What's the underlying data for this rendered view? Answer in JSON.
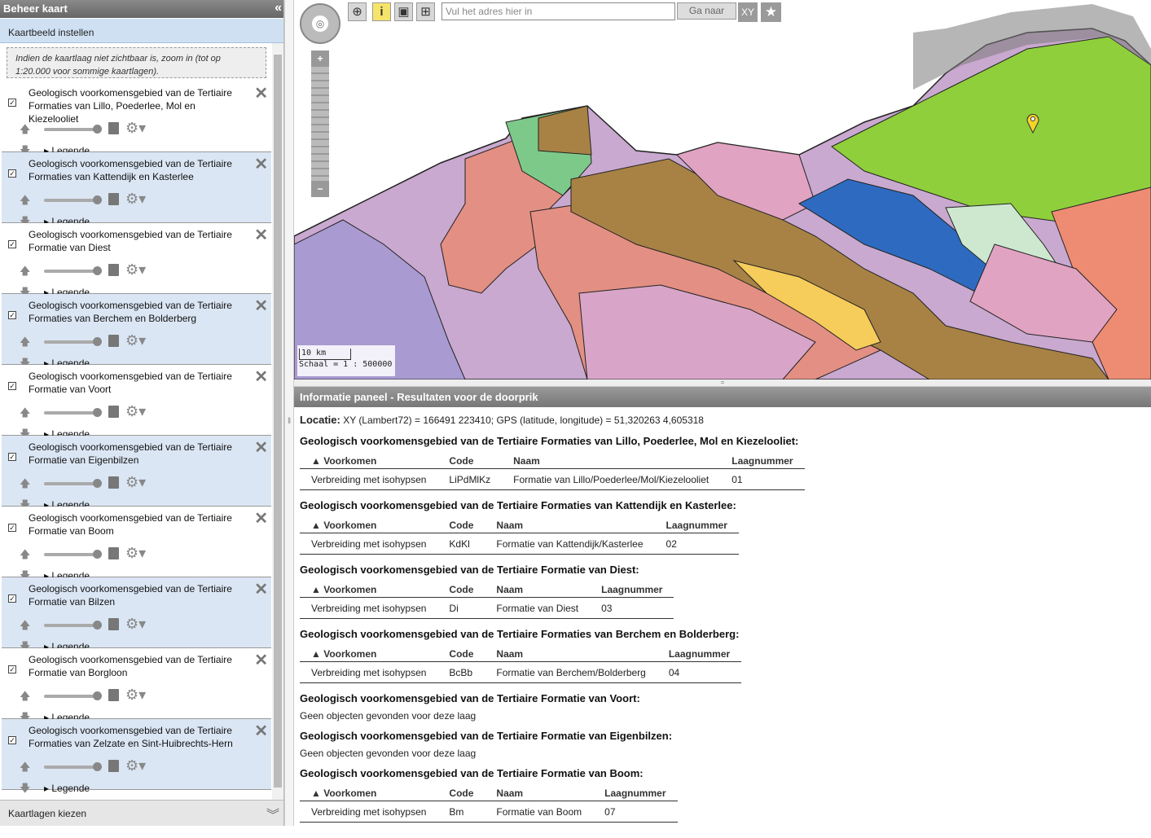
{
  "left_panel": {
    "title": "Beheer kaart",
    "section": "Kaartbeeld instellen",
    "note": "Indien de kaartlaag niet zichtbaar is, zoom in (tot op 1:20.000 voor sommige kaartlagen).",
    "legend_label": "Legende",
    "layers": [
      {
        "label": "Geologisch voorkomensgebied van de Tertiaire Formaties van Lillo, Poederlee, Mol en Kiezelooliet"
      },
      {
        "label": "Geologisch voorkomensgebied van de Tertiaire Formaties van Kattendijk en Kasterlee"
      },
      {
        "label": "Geologisch voorkomensgebied van de Tertiaire Formatie van Diest"
      },
      {
        "label": "Geologisch voorkomensgebied van de Tertiaire Formaties van Berchem en Bolderberg"
      },
      {
        "label": "Geologisch voorkomensgebied van de Tertiaire Formatie van Voort"
      },
      {
        "label": "Geologisch voorkomensgebied van de Tertiaire Formatie van Eigenbilzen"
      },
      {
        "label": "Geologisch voorkomensgebied van de Tertiaire Formatie van Boom"
      },
      {
        "label": "Geologisch voorkomensgebied van de Tertiaire Formatie van Bilzen"
      },
      {
        "label": "Geologisch voorkomensgebied van de Tertiaire Formatie van Borgloon"
      },
      {
        "label": "Geologisch voorkomensgebied van de Tertiaire Formaties van Zelzate en Sint-Huibrechts-Hern"
      }
    ],
    "footer": "Kaartlagen kiezen"
  },
  "toolbar": {
    "address_placeholder": "Vul het adres hier in",
    "go_label": "Ga naar",
    "xy_label": "XY",
    "icons": [
      "zoom-icon",
      "info-icon",
      "select-box-icon",
      "select-layer-icon",
      "star-icon"
    ]
  },
  "map": {
    "scale_bar": "10 km",
    "scale_text": "Schaal = 1 : 500000",
    "zoom_in": "+",
    "zoom_out": "−"
  },
  "info_panel": {
    "title": "Informatie paneel - Resultaten voor de doorprik",
    "location_label": "Locatie:",
    "location_value": "XY (Lambert72) = 166491 223410; GPS (latitude, longitude) = 51,320263 4,605318",
    "columns": [
      "Voorkomen",
      "Code",
      "Naam",
      "Laagnummer"
    ],
    "empty_text": "Geen objecten gevonden voor deze laag",
    "results": [
      {
        "title": "Geologisch voorkomensgebied van de Tertiaire Formaties van Lillo, Poederlee, Mol en Kiezelooliet:",
        "row": [
          "Verbreiding met isohypsen",
          "LiPdMlKz",
          "Formatie van Lillo/Poederlee/Mol/Kiezelooliet",
          "01"
        ]
      },
      {
        "title": "Geologisch voorkomensgebied van de Tertiaire Formaties van Kattendijk en Kasterlee:",
        "row": [
          "Verbreiding met isohypsen",
          "KdKl",
          "Formatie van Kattendijk/Kasterlee",
          "02"
        ]
      },
      {
        "title": "Geologisch voorkomensgebied van de Tertiaire Formatie van Diest:",
        "row": [
          "Verbreiding met isohypsen",
          "Di",
          "Formatie van Diest",
          "03"
        ]
      },
      {
        "title": "Geologisch voorkomensgebied van de Tertiaire Formaties van Berchem en Bolderberg:",
        "row": [
          "Verbreiding met isohypsen",
          "BcBb",
          "Formatie van Berchem/Bolderberg",
          "04"
        ]
      },
      {
        "title": "Geologisch voorkomensgebied van de Tertiaire Formatie van Voort:",
        "row": null
      },
      {
        "title": "Geologisch voorkomensgebied van de Tertiaire Formatie van Eigenbilzen:",
        "row": null
      },
      {
        "title": "Geologisch voorkomensgebied van de Tertiaire Formatie van Boom:",
        "row": [
          "Verbreiding met isohypsen",
          "Bm",
          "Formatie van Boom",
          "07"
        ]
      }
    ]
  },
  "colors": {
    "panel_header": "#777777",
    "section_blue": "#cfe0f3",
    "alt_row": "#dbe6f4",
    "map_green": "#8fcf3c",
    "map_brown": "#a88245",
    "map_pink": "#e1a3c2",
    "map_salmon": "#e38f83",
    "map_blue": "#2e6bc0",
    "map_purple": "#a99ad1"
  }
}
